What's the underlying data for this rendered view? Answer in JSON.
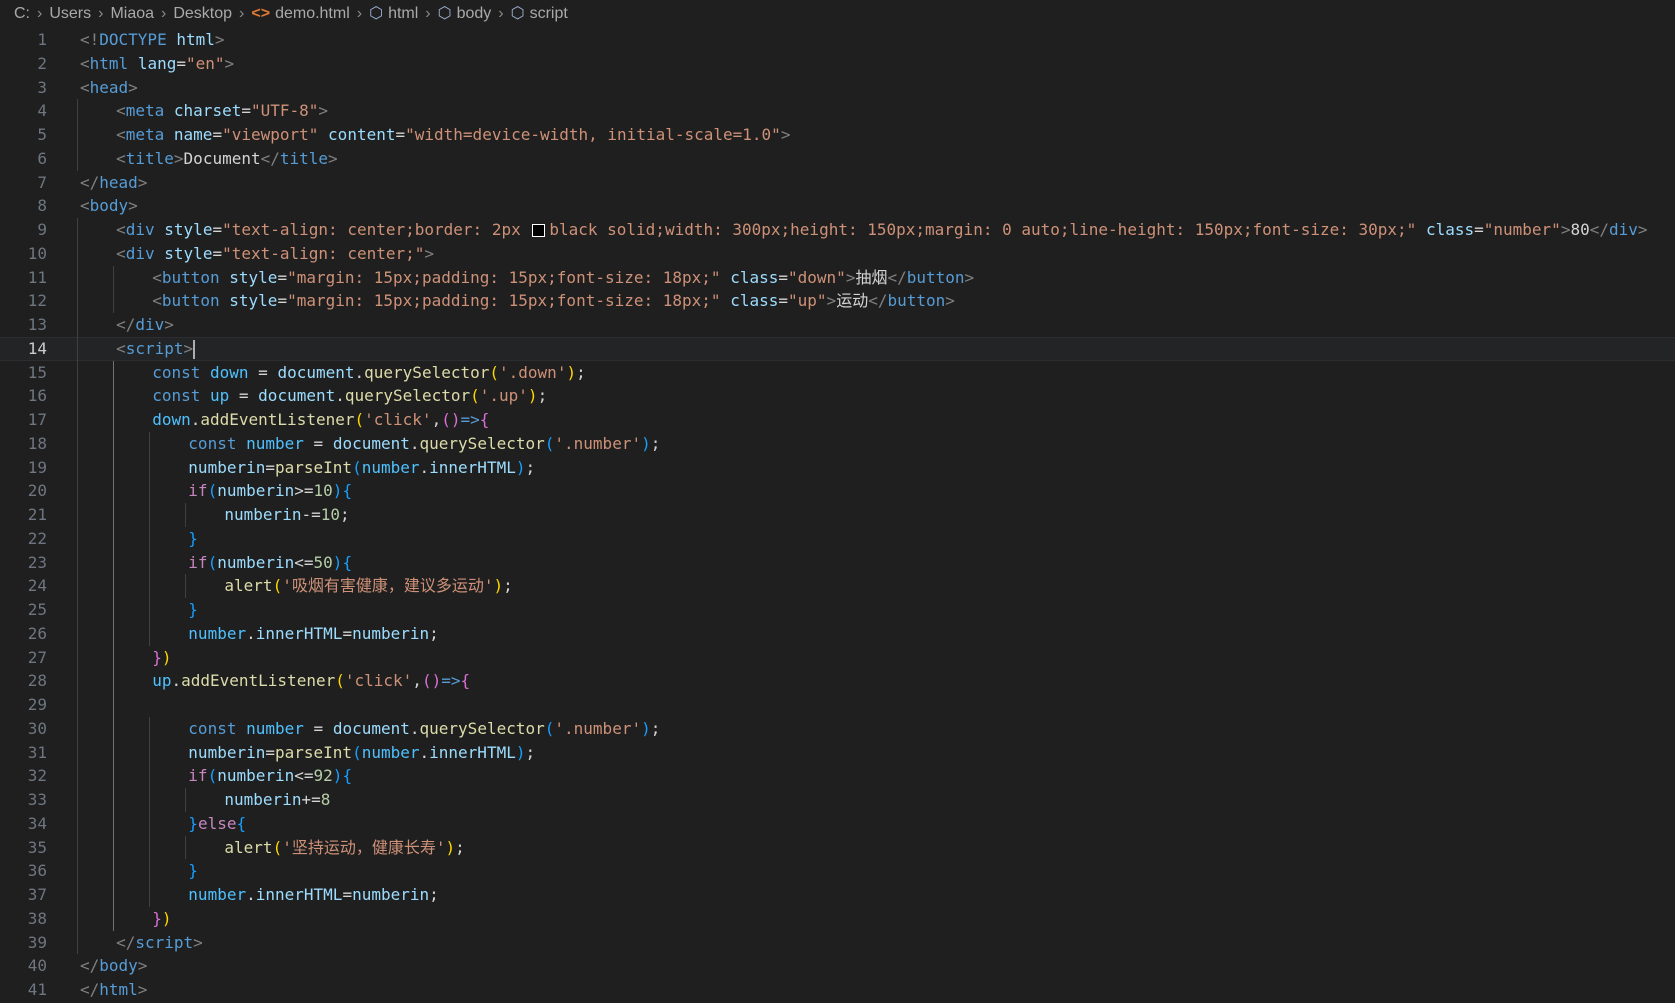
{
  "breadcrumb": [
    {
      "label": "C:",
      "icon": ""
    },
    {
      "label": "Users",
      "icon": ""
    },
    {
      "label": "Miaoa",
      "icon": ""
    },
    {
      "label": "Desktop",
      "icon": ""
    },
    {
      "label": "demo.html",
      "icon": "html-file-icon"
    },
    {
      "label": "html",
      "icon": "element-cube-icon"
    },
    {
      "label": "body",
      "icon": "element-cube-icon"
    },
    {
      "label": "script",
      "icon": "element-cube-icon"
    }
  ],
  "editor": {
    "current_line": 14,
    "lines": [
      {
        "n": "1",
        "indent": 0,
        "segs": [
          [
            "tg",
            "<!"
          ],
          [
            "tn",
            "DOCTYPE"
          ],
          [
            "tx",
            " "
          ],
          [
            "at",
            "html"
          ],
          [
            "tg",
            ">"
          ]
        ]
      },
      {
        "n": "2",
        "indent": 0,
        "segs": [
          [
            "tg",
            "<"
          ],
          [
            "tn",
            "html"
          ],
          [
            "tx",
            " "
          ],
          [
            "at",
            "lang"
          ],
          [
            "tx",
            "="
          ],
          [
            "st",
            "\"en\""
          ],
          [
            "tg",
            ">"
          ]
        ]
      },
      {
        "n": "3",
        "indent": 0,
        "segs": [
          [
            "tg",
            "<"
          ],
          [
            "tn",
            "head"
          ],
          [
            "tg",
            ">"
          ]
        ]
      },
      {
        "n": "4",
        "indent": 1,
        "segs": [
          [
            "tg",
            "<"
          ],
          [
            "tn",
            "meta"
          ],
          [
            "tx",
            " "
          ],
          [
            "at",
            "charset"
          ],
          [
            "tx",
            "="
          ],
          [
            "st",
            "\"UTF-8\""
          ],
          [
            "tg",
            ">"
          ]
        ]
      },
      {
        "n": "5",
        "indent": 1,
        "segs": [
          [
            "tg",
            "<"
          ],
          [
            "tn",
            "meta"
          ],
          [
            "tx",
            " "
          ],
          [
            "at",
            "name"
          ],
          [
            "tx",
            "="
          ],
          [
            "st",
            "\"viewport\""
          ],
          [
            "tx",
            " "
          ],
          [
            "at",
            "content"
          ],
          [
            "tx",
            "="
          ],
          [
            "st",
            "\"width=device-width, initial-scale=1.0\""
          ],
          [
            "tg",
            ">"
          ]
        ]
      },
      {
        "n": "6",
        "indent": 1,
        "segs": [
          [
            "tg",
            "<"
          ],
          [
            "tn",
            "title"
          ],
          [
            "tg",
            ">"
          ],
          [
            "tx",
            "Document"
          ],
          [
            "tg",
            "</"
          ],
          [
            "tn",
            "title"
          ],
          [
            "tg",
            ">"
          ]
        ]
      },
      {
        "n": "7",
        "indent": 0,
        "segs": [
          [
            "tg",
            "</"
          ],
          [
            "tn",
            "head"
          ],
          [
            "tg",
            ">"
          ]
        ]
      },
      {
        "n": "8",
        "indent": 0,
        "segs": [
          [
            "tg",
            "<"
          ],
          [
            "tn",
            "body"
          ],
          [
            "tg",
            ">"
          ]
        ]
      },
      {
        "n": "9",
        "indent": 1,
        "segs": [
          [
            "tg",
            "<"
          ],
          [
            "tn",
            "div"
          ],
          [
            "tx",
            " "
          ],
          [
            "at",
            "style"
          ],
          [
            "tx",
            "="
          ],
          [
            "st",
            "\"text-align: center;border: 2px "
          ],
          [
            "swatch",
            ""
          ],
          [
            "st",
            "black solid;width: 300px;height: 150px;margin: 0 auto;line-height: 150px;font-size: 30px;\""
          ],
          [
            "tx",
            " "
          ],
          [
            "at",
            "class"
          ],
          [
            "tx",
            "="
          ],
          [
            "st",
            "\"number\""
          ],
          [
            "tg",
            ">"
          ],
          [
            "tx",
            "80"
          ],
          [
            "tg",
            "</"
          ],
          [
            "tn",
            "div"
          ],
          [
            "tg",
            ">"
          ]
        ]
      },
      {
        "n": "10",
        "indent": 1,
        "segs": [
          [
            "tg",
            "<"
          ],
          [
            "tn",
            "div"
          ],
          [
            "tx",
            " "
          ],
          [
            "at",
            "style"
          ],
          [
            "tx",
            "="
          ],
          [
            "st",
            "\"text-align: center;\""
          ],
          [
            "tg",
            ">"
          ]
        ]
      },
      {
        "n": "11",
        "indent": 2,
        "segs": [
          [
            "tg",
            "<"
          ],
          [
            "tn",
            "button"
          ],
          [
            "tx",
            " "
          ],
          [
            "at",
            "style"
          ],
          [
            "tx",
            "="
          ],
          [
            "st",
            "\"margin: 15px;padding: 15px;font-size: 18px;\""
          ],
          [
            "tx",
            " "
          ],
          [
            "at",
            "class"
          ],
          [
            "tx",
            "="
          ],
          [
            "st",
            "\"down\""
          ],
          [
            "tg",
            ">"
          ],
          [
            "tx",
            "抽烟"
          ],
          [
            "tg",
            "</"
          ],
          [
            "tn",
            "button"
          ],
          [
            "tg",
            ">"
          ]
        ]
      },
      {
        "n": "12",
        "indent": 2,
        "segs": [
          [
            "tg",
            "<"
          ],
          [
            "tn",
            "button"
          ],
          [
            "tx",
            " "
          ],
          [
            "at",
            "style"
          ],
          [
            "tx",
            "="
          ],
          [
            "st",
            "\"margin: 15px;padding: 15px;font-size: 18px;\""
          ],
          [
            "tx",
            " "
          ],
          [
            "at",
            "class"
          ],
          [
            "tx",
            "="
          ],
          [
            "st",
            "\"up\""
          ],
          [
            "tg",
            ">"
          ],
          [
            "tx",
            "运动"
          ],
          [
            "tg",
            "</"
          ],
          [
            "tn",
            "button"
          ],
          [
            "tg",
            ">"
          ]
        ]
      },
      {
        "n": "13",
        "indent": 1,
        "segs": [
          [
            "tg",
            "</"
          ],
          [
            "tn",
            "div"
          ],
          [
            "tg",
            ">"
          ]
        ]
      },
      {
        "n": "14",
        "indent": 1,
        "segs": [
          [
            "tg",
            "<"
          ],
          [
            "tn",
            "script"
          ],
          [
            "tg",
            ">"
          ],
          [
            "cursor",
            ""
          ]
        ]
      },
      {
        "n": "15",
        "indent": 2,
        "segs": [
          [
            "kw",
            "const"
          ],
          [
            "tx",
            " "
          ],
          [
            "va",
            "down"
          ],
          [
            "op",
            " = "
          ],
          [
            "pr",
            "document"
          ],
          [
            "op",
            "."
          ],
          [
            "fn",
            "querySelector"
          ],
          [
            "b1",
            "("
          ],
          [
            "st",
            "'.down'"
          ],
          [
            "b1",
            ")"
          ],
          [
            "op",
            ";"
          ]
        ]
      },
      {
        "n": "16",
        "indent": 2,
        "segs": [
          [
            "kw",
            "const"
          ],
          [
            "tx",
            " "
          ],
          [
            "va",
            "up"
          ],
          [
            "op",
            " = "
          ],
          [
            "pr",
            "document"
          ],
          [
            "op",
            "."
          ],
          [
            "fn",
            "querySelector"
          ],
          [
            "b1",
            "("
          ],
          [
            "st",
            "'.up'"
          ],
          [
            "b1",
            ")"
          ],
          [
            "op",
            ";"
          ]
        ]
      },
      {
        "n": "17",
        "indent": 2,
        "segs": [
          [
            "va",
            "down"
          ],
          [
            "op",
            "."
          ],
          [
            "fn",
            "addEventListener"
          ],
          [
            "b1",
            "("
          ],
          [
            "st",
            "'click'"
          ],
          [
            "op",
            ","
          ],
          [
            "b2",
            "()"
          ],
          [
            "kw",
            "=>"
          ],
          [
            "b2",
            "{"
          ]
        ]
      },
      {
        "n": "18",
        "indent": 3,
        "segs": [
          [
            "kw",
            "const"
          ],
          [
            "tx",
            " "
          ],
          [
            "va",
            "number"
          ],
          [
            "op",
            " = "
          ],
          [
            "pr",
            "document"
          ],
          [
            "op",
            "."
          ],
          [
            "fn",
            "querySelector"
          ],
          [
            "b3",
            "("
          ],
          [
            "st",
            "'.number'"
          ],
          [
            "b3",
            ")"
          ],
          [
            "op",
            ";"
          ]
        ]
      },
      {
        "n": "19",
        "indent": 3,
        "segs": [
          [
            "pr",
            "numberin"
          ],
          [
            "op",
            "="
          ],
          [
            "fn",
            "parseInt"
          ],
          [
            "b3",
            "("
          ],
          [
            "va",
            "number"
          ],
          [
            "op",
            "."
          ],
          [
            "pr",
            "innerHTML"
          ],
          [
            "b3",
            ")"
          ],
          [
            "op",
            ";"
          ]
        ]
      },
      {
        "n": "20",
        "indent": 3,
        "segs": [
          [
            "ctl",
            "if"
          ],
          [
            "b3",
            "("
          ],
          [
            "pr",
            "numberin"
          ],
          [
            "op",
            ">="
          ],
          [
            "nu",
            "10"
          ],
          [
            "b3",
            ")"
          ],
          [
            "b3",
            "{"
          ]
        ]
      },
      {
        "n": "21",
        "indent": 4,
        "segs": [
          [
            "pr",
            "numberin"
          ],
          [
            "op",
            "-="
          ],
          [
            "nu",
            "10"
          ],
          [
            "op",
            ";"
          ]
        ]
      },
      {
        "n": "22",
        "indent": 3,
        "segs": [
          [
            "b3",
            "}"
          ]
        ]
      },
      {
        "n": "23",
        "indent": 3,
        "segs": [
          [
            "ctl",
            "if"
          ],
          [
            "b3",
            "("
          ],
          [
            "pr",
            "numberin"
          ],
          [
            "op",
            "<="
          ],
          [
            "nu",
            "50"
          ],
          [
            "b3",
            ")"
          ],
          [
            "b3",
            "{"
          ]
        ]
      },
      {
        "n": "24",
        "indent": 4,
        "segs": [
          [
            "fn",
            "alert"
          ],
          [
            "b1",
            "("
          ],
          [
            "st",
            "'吸烟有害健康，建议多运动'"
          ],
          [
            "b1",
            ")"
          ],
          [
            "op",
            ";"
          ]
        ]
      },
      {
        "n": "25",
        "indent": 3,
        "segs": [
          [
            "b3",
            "}"
          ]
        ]
      },
      {
        "n": "26",
        "indent": 3,
        "segs": [
          [
            "va",
            "number"
          ],
          [
            "op",
            "."
          ],
          [
            "pr",
            "innerHTML"
          ],
          [
            "op",
            "="
          ],
          [
            "pr",
            "numberin"
          ],
          [
            "op",
            ";"
          ]
        ]
      },
      {
        "n": "27",
        "indent": 2,
        "segs": [
          [
            "b2",
            "}"
          ],
          [
            "b1",
            ")"
          ]
        ]
      },
      {
        "n": "28",
        "indent": 2,
        "segs": [
          [
            "va",
            "up"
          ],
          [
            "op",
            "."
          ],
          [
            "fn",
            "addEventListener"
          ],
          [
            "b1",
            "("
          ],
          [
            "st",
            "'click'"
          ],
          [
            "op",
            ","
          ],
          [
            "b2",
            "()"
          ],
          [
            "kw",
            "=>"
          ],
          [
            "b2",
            "{"
          ]
        ]
      },
      {
        "n": "29",
        "indent": 0,
        "segs": []
      },
      {
        "n": "30",
        "indent": 3,
        "segs": [
          [
            "kw",
            "const"
          ],
          [
            "tx",
            " "
          ],
          [
            "va",
            "number"
          ],
          [
            "op",
            " = "
          ],
          [
            "pr",
            "document"
          ],
          [
            "op",
            "."
          ],
          [
            "fn",
            "querySelector"
          ],
          [
            "b3",
            "("
          ],
          [
            "st",
            "'.number'"
          ],
          [
            "b3",
            ")"
          ],
          [
            "op",
            ";"
          ]
        ]
      },
      {
        "n": "31",
        "indent": 3,
        "segs": [
          [
            "pr",
            "numberin"
          ],
          [
            "op",
            "="
          ],
          [
            "fn",
            "parseInt"
          ],
          [
            "b3",
            "("
          ],
          [
            "va",
            "number"
          ],
          [
            "op",
            "."
          ],
          [
            "pr",
            "innerHTML"
          ],
          [
            "b3",
            ")"
          ],
          [
            "op",
            ";"
          ]
        ]
      },
      {
        "n": "32",
        "indent": 3,
        "segs": [
          [
            "ctl",
            "if"
          ],
          [
            "b3",
            "("
          ],
          [
            "pr",
            "numberin"
          ],
          [
            "op",
            "<="
          ],
          [
            "nu",
            "92"
          ],
          [
            "b3",
            ")"
          ],
          [
            "b3",
            "{"
          ]
        ]
      },
      {
        "n": "33",
        "indent": 4,
        "segs": [
          [
            "pr",
            "numberin"
          ],
          [
            "op",
            "+="
          ],
          [
            "nu",
            "8"
          ]
        ]
      },
      {
        "n": "34",
        "indent": 3,
        "segs": [
          [
            "b3",
            "}"
          ],
          [
            "ctl",
            "else"
          ],
          [
            "b3",
            "{"
          ]
        ]
      },
      {
        "n": "35",
        "indent": 4,
        "segs": [
          [
            "fn",
            "alert"
          ],
          [
            "b1",
            "("
          ],
          [
            "st",
            "'坚持运动，健康长寿'"
          ],
          [
            "b1",
            ")"
          ],
          [
            "op",
            ";"
          ]
        ]
      },
      {
        "n": "36",
        "indent": 3,
        "segs": [
          [
            "b3",
            "}"
          ]
        ]
      },
      {
        "n": "37",
        "indent": 3,
        "segs": [
          [
            "va",
            "number"
          ],
          [
            "op",
            "."
          ],
          [
            "pr",
            "innerHTML"
          ],
          [
            "op",
            "="
          ],
          [
            "pr",
            "numberin"
          ],
          [
            "op",
            ";"
          ]
        ]
      },
      {
        "n": "38",
        "indent": 2,
        "segs": [
          [
            "b2",
            "}"
          ],
          [
            "b1",
            ")"
          ]
        ]
      },
      {
        "n": "39",
        "indent": 1,
        "segs": [
          [
            "tg",
            "</"
          ],
          [
            "tn",
            "script"
          ],
          [
            "tg",
            ">"
          ]
        ]
      },
      {
        "n": "40",
        "indent": 0,
        "segs": [
          [
            "tg",
            "</"
          ],
          [
            "tn",
            "body"
          ],
          [
            "tg",
            ">"
          ]
        ]
      },
      {
        "n": "41",
        "indent": 0,
        "segs": [
          [
            "tg",
            "</"
          ],
          [
            "tn",
            "html"
          ],
          [
            "tg",
            ">"
          ]
        ]
      }
    ]
  }
}
